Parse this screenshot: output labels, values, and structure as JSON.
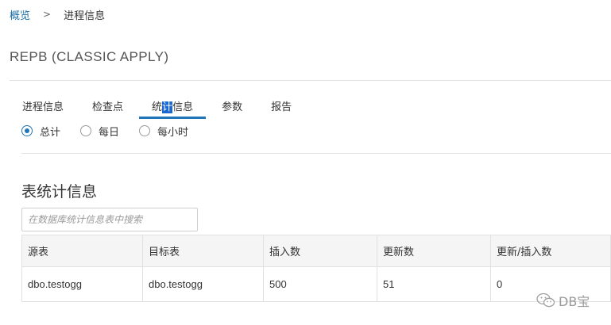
{
  "breadcrumb": {
    "root": "概览",
    "separator": ">",
    "current": "进程信息"
  },
  "page": {
    "title": "REPB (CLASSIC APPLY)"
  },
  "tabs": [
    {
      "label": "进程信息",
      "active": false
    },
    {
      "label": "检查点",
      "active": false
    },
    {
      "label_pre": "统",
      "label_hl": "计",
      "label_post": "信息",
      "active": true
    },
    {
      "label": "参数",
      "active": false
    },
    {
      "label": "报告",
      "active": false
    }
  ],
  "radios": [
    {
      "label": "总计",
      "checked": true
    },
    {
      "label": "每日",
      "checked": false
    },
    {
      "label": "每小时",
      "checked": false
    }
  ],
  "table_section": {
    "title": "表统计信息",
    "search_placeholder": "在数据库统计信息表中搜索",
    "columns": [
      "源表",
      "目标表",
      "插入数",
      "更新数",
      "更新/插入数"
    ],
    "rows": [
      [
        "dbo.testogg",
        "dbo.testogg",
        "500",
        "51",
        "0"
      ]
    ]
  },
  "watermark": {
    "text": "DB宝"
  },
  "colors": {
    "accent": "#1f75b8",
    "link": "#1a6fa8",
    "text_highlight": "#1967d2"
  }
}
